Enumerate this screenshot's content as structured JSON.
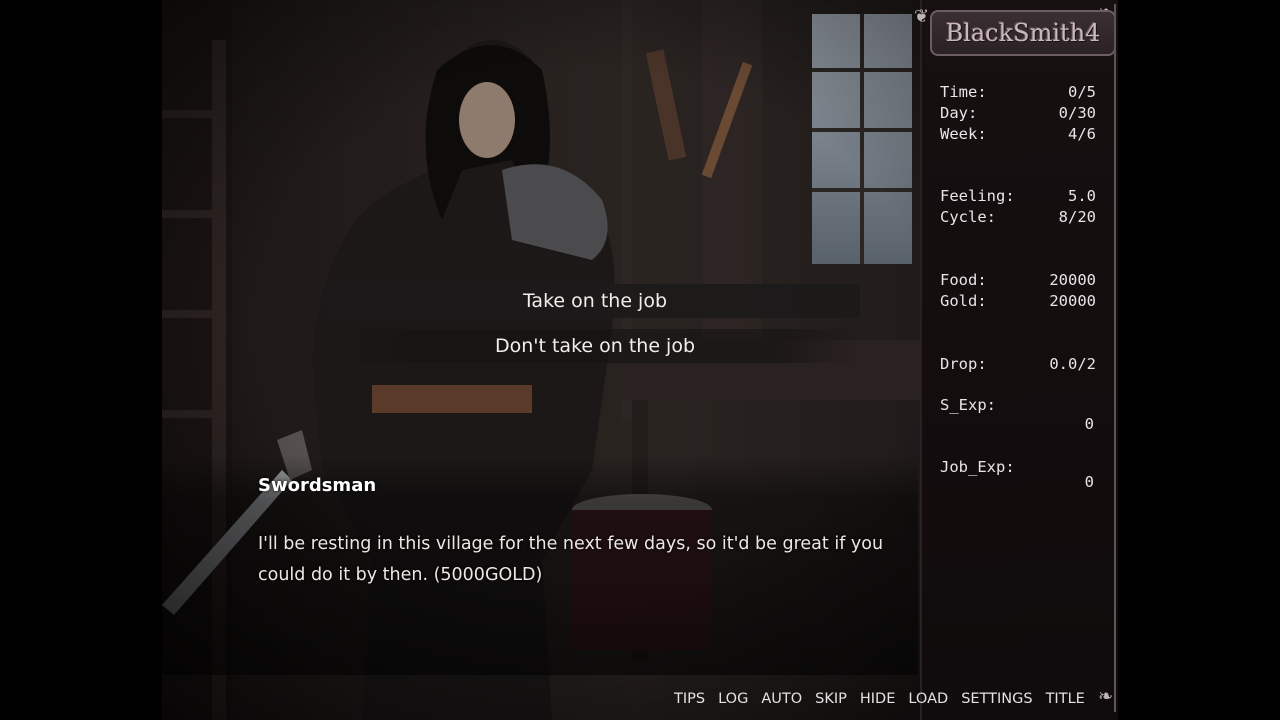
{
  "game": {
    "logo": "BlackSmith4"
  },
  "choices": [
    {
      "label": "Take on the job"
    },
    {
      "label": "Don't take on the job"
    }
  ],
  "dialogue": {
    "speaker": "Swordsman",
    "text": "I'll be resting in this village for the next few days, so it'd be great if you could do it by then. (5000GOLD)"
  },
  "stats": {
    "time": {
      "label": "Time:",
      "value": "0/5"
    },
    "day": {
      "label": "Day:",
      "value": "0/30"
    },
    "week": {
      "label": "Week:",
      "value": "4/6"
    },
    "feeling": {
      "label": "Feeling:",
      "value": "5.0"
    },
    "cycle": {
      "label": "Cycle:",
      "value": "8/20"
    },
    "food": {
      "label": "Food:",
      "value": "20000"
    },
    "gold": {
      "label": "Gold:",
      "value": "20000"
    },
    "drop": {
      "label": "Drop:",
      "value": "0.0/2"
    },
    "s_exp": {
      "label": "S_Exp:",
      "value": "0"
    },
    "job_exp": {
      "label": "Job_Exp:",
      "value": "0"
    }
  },
  "quick_menu": [
    "TIPS",
    "LOG",
    "AUTO",
    "SKIP",
    "HIDE",
    "LOAD",
    "SETTINGS",
    "TITLE"
  ],
  "colors": {
    "panel_bg": "#150f10",
    "text": "#ece7e2",
    "logo_plate": "#3a2f33"
  }
}
